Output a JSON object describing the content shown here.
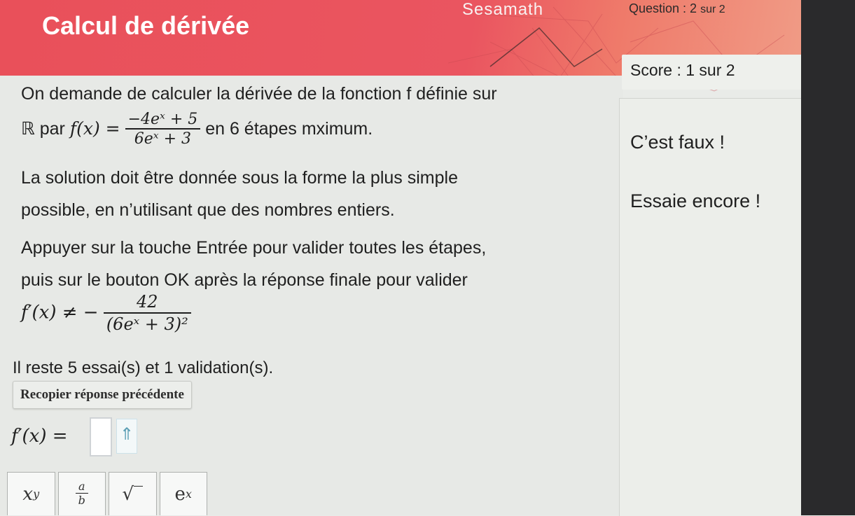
{
  "header": {
    "title": "Calcul de dérivée",
    "brand": "Sesamath",
    "question_label": "Question : 2",
    "question_total": "sur 2",
    "score": "Score : 1 sur 2"
  },
  "statement": {
    "line1": "On demande de calculer la dérivée de la fonction f définie sur",
    "line2_prefix": "ℝ par",
    "func_lhs": "f(x) =",
    "func_num": "−4eˣ + 5",
    "func_den": "6eˣ + 3",
    "line2_suffix": "en 6 étapes mximum.",
    "line3": "La solution doit être donnée sous la forme la plus simple",
    "line4": "possible, en n’utilisant que des nombres entiers.",
    "line5": "Appuyer sur la touche Entrée pour valider toutes les étapes,",
    "line6": "puis sur le bouton OK après la réponse finale pour valider"
  },
  "previous_answer": {
    "lhs": "f′(x) ≠ −",
    "num": "42",
    "den": "(6eˣ + 3)²"
  },
  "remaining": "Il reste 5 essai(s) et 1 validation(s).",
  "recopier_label": "Recopier réponse précédente",
  "answer_lhs": "f′(x) =",
  "arrow_glyph": "⇑",
  "feedback": {
    "wrong": "C’est faux !",
    "retry": "Essaie encore !"
  },
  "toolbar": {
    "power_base": "x",
    "power_exp": "y",
    "fraction_num": "a",
    "fraction_den": "b",
    "sqrt": "√‾",
    "exp_base": "e",
    "exp_exp": "x"
  },
  "colors": {
    "header_red": "#e9505a",
    "header_orange": "#f0a58e",
    "panel_bg": "#e7e9e6"
  },
  "icons": [
    "up-arrow-icon"
  ]
}
